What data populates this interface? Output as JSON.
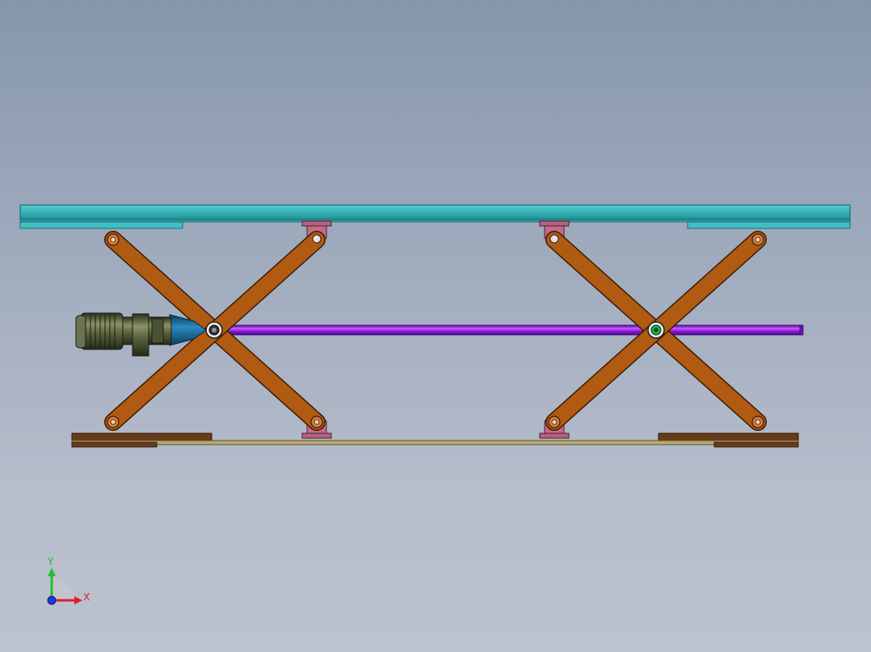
{
  "triad": {
    "x_label": "X",
    "y_label": "Y",
    "x_color": "#e0202a",
    "y_color": "#22c02a",
    "z_color": "#1a3adf"
  },
  "colors": {
    "platform": "#35b2b5",
    "platform_edge": "#1c6e72",
    "arm": "#b05a12",
    "arm_edge": "#3a1c04",
    "bracket": "#c76a8a",
    "shaft": "#8a1ed8",
    "base_dark": "#6a3a1a",
    "base_rail": "#b8aa70",
    "motor": "#5c6440",
    "coupling": "#1f6e9a"
  },
  "components": [
    "top-platform",
    "scissor-arm-left",
    "scissor-arm-right",
    "mounting-bracket",
    "drive-shaft",
    "gear-motor",
    "base-frame"
  ]
}
